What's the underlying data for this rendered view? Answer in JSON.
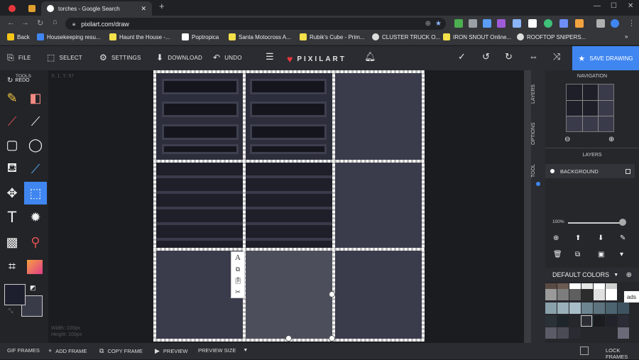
{
  "browser": {
    "tabs": [
      {
        "title": "",
        "favicon": "#e8383d"
      },
      {
        "title": "",
        "favicon": "#e0a030"
      },
      {
        "title": "torches - Google Search",
        "favicon": "#ffffff"
      }
    ],
    "new_tab_icon": "+",
    "url": "pixilart.com/draw",
    "bookmarks": [
      {
        "label": "Back",
        "color": "#f5c518"
      },
      {
        "label": "Housekeeping resu...",
        "color": "#3f86f1"
      },
      {
        "label": "Haunt the House -...",
        "color": "#f5e14a"
      },
      {
        "label": "Poptropica",
        "color": "#ffffff"
      },
      {
        "label": "Santa Motocross A...",
        "color": "#f5e14a"
      },
      {
        "label": "Rubik's Cube - Prim...",
        "color": "#f5e14a"
      },
      {
        "label": "CLUSTER TRUCK O...",
        "color": "#dddddd"
      },
      {
        "label": "IRON SNOUT Online...",
        "color": "#f5e14a"
      },
      {
        "label": "ROOFTOP SNIPERS...",
        "color": "#dddddd"
      }
    ],
    "bookmarks_more": "»"
  },
  "app": {
    "menu": {
      "file": "FILE",
      "select": "SELECT",
      "settings": "SETTINGS",
      "download": "DOWNLOAD",
      "undo": "UNDO"
    },
    "logo_text": "PIXILART",
    "save_label": "SAVE DRAWING",
    "accent": "#3f86f1"
  },
  "tools": {
    "tools_label": "TOOLS",
    "redo_label": "REDO",
    "primary_color": "#1e1f2e",
    "secondary_color": "#3a3b48"
  },
  "canvas": {
    "coords": "X: 1, Y: 57",
    "width_label": "Width: 100px",
    "height_label": "Height: 100px"
  },
  "side_tabs": {
    "layers": "LAYERS",
    "options": "OPTIONS",
    "tool": "TOOL"
  },
  "panel": {
    "navigation_title": "NAVIGATION",
    "layers_title": "LAYERS",
    "layer_name": "BACKGROUND",
    "opacity": "100%",
    "default_colors": "DEFAULT COLORS",
    "ads_label": "ads"
  },
  "bottom": {
    "gif_frames": "GIF FRAMES",
    "add_frame": "ADD FRAME",
    "copy_frame": "COPY FRAME",
    "preview": "PREVIEW",
    "preview_size": "PREVIEW SIZE",
    "lock_frames": "LOCK FRAMES"
  }
}
